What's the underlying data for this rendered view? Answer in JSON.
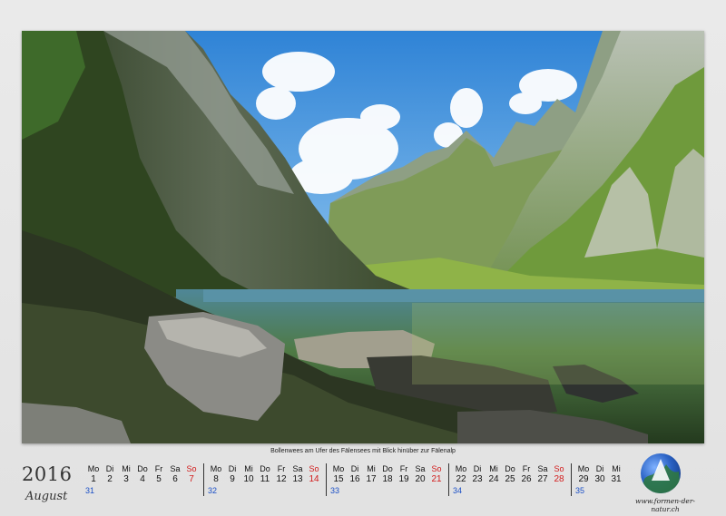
{
  "caption": "Bollenwees am Ufer des Fälensees mit Blick hinüber zur Fälenalp",
  "year": "2016",
  "month": "August",
  "weeks": [
    {
      "headers": [
        "Mo",
        "Di",
        "Mi",
        "Do",
        "Fr",
        "Sa",
        "So"
      ],
      "dates": [
        "1",
        "2",
        "3",
        "4",
        "5",
        "6",
        "7"
      ],
      "kw": "31"
    },
    {
      "headers": [
        "Mo",
        "Di",
        "Mi",
        "Do",
        "Fr",
        "Sa",
        "So"
      ],
      "dates": [
        "8",
        "9",
        "10",
        "11",
        "12",
        "13",
        "14"
      ],
      "kw": "32"
    },
    {
      "headers": [
        "Mo",
        "Di",
        "Mi",
        "Do",
        "Fr",
        "Sa",
        "So"
      ],
      "dates": [
        "15",
        "16",
        "17",
        "18",
        "19",
        "20",
        "21"
      ],
      "kw": "33"
    },
    {
      "headers": [
        "Mo",
        "Di",
        "Mi",
        "Do",
        "Fr",
        "Sa",
        "So"
      ],
      "dates": [
        "22",
        "23",
        "24",
        "25",
        "26",
        "27",
        "28"
      ],
      "kw": "34"
    },
    {
      "headers": [
        "Mo",
        "Di",
        "Mi"
      ],
      "dates": [
        "29",
        "30",
        "31"
      ],
      "kw": "35"
    }
  ],
  "logo": {
    "url": "www.formen-der-natur.ch",
    "icon": "globe-logo-icon"
  },
  "colors": {
    "sunday": "#d21a1a",
    "week_number": "#1a4fc6",
    "sky": "#3b8fd9",
    "lake": "#3f6b4a"
  }
}
